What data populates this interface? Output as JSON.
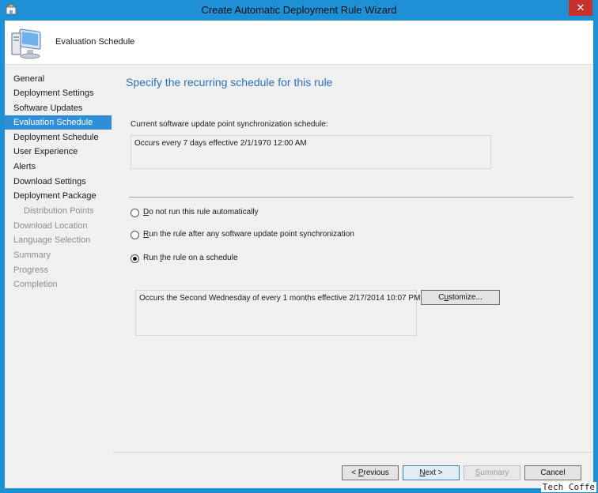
{
  "window": {
    "title": "Create Automatic Deployment Rule Wizard",
    "close_glyph": "✕",
    "title_icon": "wizard-app-icon"
  },
  "header": {
    "title": "Evaluation Schedule",
    "icon": "computer-monitor-icon"
  },
  "sidebar": {
    "items": [
      {
        "label": "General",
        "state": "normal"
      },
      {
        "label": "Deployment Settings",
        "state": "normal"
      },
      {
        "label": "Software Updates",
        "state": "normal"
      },
      {
        "label": "Evaluation Schedule",
        "state": "active"
      },
      {
        "label": "Deployment Schedule",
        "state": "normal"
      },
      {
        "label": "User Experience",
        "state": "normal"
      },
      {
        "label": "Alerts",
        "state": "normal"
      },
      {
        "label": "Download Settings",
        "state": "normal"
      },
      {
        "label": "Deployment Package",
        "state": "normal"
      },
      {
        "label": "Distribution Points",
        "state": "disabled-sub"
      },
      {
        "label": "Download Location",
        "state": "disabled"
      },
      {
        "label": "Language Selection",
        "state": "disabled"
      },
      {
        "label": "Summary",
        "state": "disabled"
      },
      {
        "label": "Progress",
        "state": "disabled"
      },
      {
        "label": "Completion",
        "state": "disabled"
      }
    ]
  },
  "main": {
    "heading": "Specify the recurring schedule for this rule",
    "sync_label": "Current software update point synchronization schedule:",
    "sync_value": "Occurs every 7 days effective 2/1/1970 12:00 AM",
    "options": {
      "no_run": {
        "accel": "D",
        "rest": "o not run this rule automatically",
        "checked": false
      },
      "after_sync": {
        "accel": "R",
        "rest": "un the rule after any software update point synchronization",
        "checked": false
      },
      "schedule": {
        "pre": "Run ",
        "accel": "t",
        "rest": "he rule on a schedule",
        "checked": true
      }
    },
    "schedule_value": "Occurs the Second Wednesday of every 1 months effective 2/17/2014 10:07 PM",
    "customize": {
      "pre": "C",
      "accel": "u",
      "rest": "stomize..."
    }
  },
  "footer": {
    "previous": {
      "pre": "< ",
      "accel": "P",
      "rest": "revious"
    },
    "next": {
      "accel": "N",
      "rest": "ext >"
    },
    "summary": {
      "accel": "S",
      "rest": "ummary"
    },
    "cancel": "Cancel"
  },
  "watermark": "Tech Coffe",
  "colors": {
    "frame": "#1e90d6",
    "close": "#c7302b",
    "active_nav": "#2f8ed6",
    "heading": "#2b71b8",
    "panel": "#f0f0f0"
  }
}
